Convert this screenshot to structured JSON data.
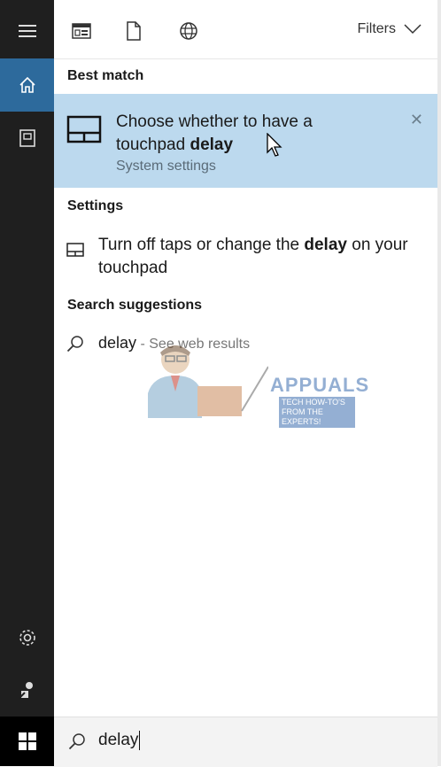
{
  "topbar": {
    "filters_label": "Filters",
    "icons": [
      "apps-icon",
      "document-icon",
      "web-globe-icon"
    ]
  },
  "sections": {
    "best_match": "Best match",
    "settings": "Settings",
    "search_suggestions": "Search suggestions"
  },
  "best_match": {
    "title_prefix": "Choose whether to have a touchpad ",
    "title_bold": "delay",
    "subtitle": "System settings",
    "close": "✕",
    "icon": "touchpad-icon"
  },
  "settings_result": {
    "text_prefix": "Turn off taps or change the ",
    "text_bold": "delay",
    "text_suffix": " on your touchpad",
    "icon": "touchpad-small-icon"
  },
  "suggestion": {
    "query": "delay",
    "hint": " - See web results",
    "icon": "search-icon"
  },
  "watermark": {
    "brand": "APPUALS",
    "tagline": "TECH HOW-TO'S FROM THE EXPERTS!"
  },
  "search": {
    "value": "delay",
    "icon": "search-icon"
  },
  "rail": {
    "items": [
      "menu-icon",
      "home-icon",
      "notebook-icon"
    ],
    "bottom": [
      "settings-gear-icon",
      "feedback-icon",
      "windows-start-icon"
    ]
  },
  "colors": {
    "rail_bg": "#1f1f1f",
    "rail_active": "#2d6a9c",
    "best_match_bg": "#bcd9ee",
    "searchbox_bg": "#f3f3f3"
  }
}
